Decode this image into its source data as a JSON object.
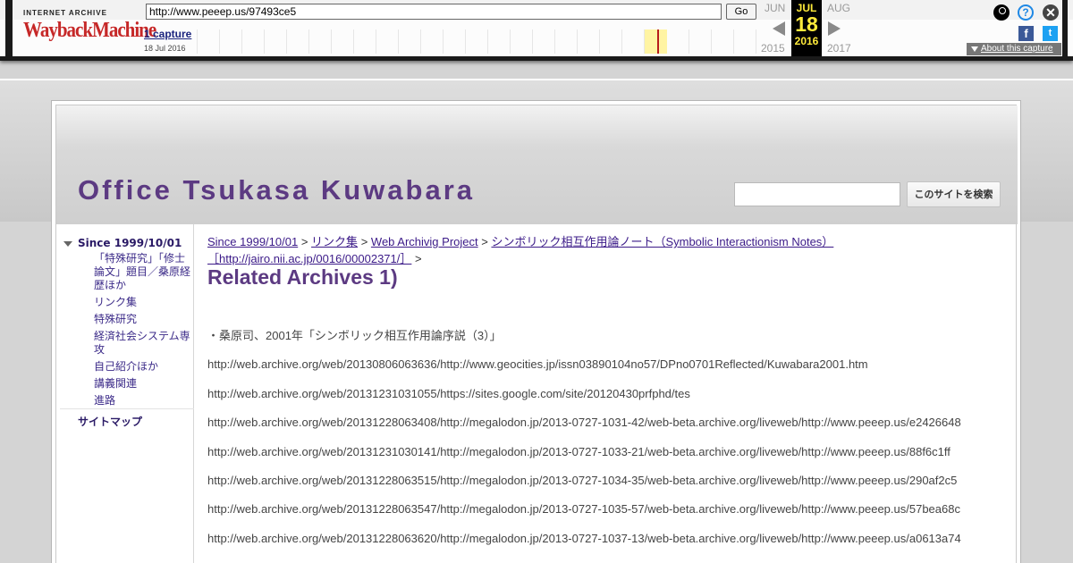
{
  "wayback": {
    "logo_top": "INTERNET ARCHIVE",
    "logo_main": "WaybackMachine",
    "url": "http://www.peeep.us/97493ce5",
    "go_label": "Go",
    "captures_label": "1 capture",
    "capture_date": "18 Jul 2016",
    "prev_month": "JUN",
    "current_month": "JUL",
    "next_month": "AUG",
    "current_day": "18",
    "prev_year": "2015",
    "current_year": "2016",
    "next_year": "2017",
    "about_label": "About this capture",
    "help_glyph": "?",
    "close_glyph": "✕",
    "facebook_glyph": "f",
    "twitter_glyph": "t"
  },
  "site": {
    "title": "Office Tsukasa Kuwabara",
    "search_button": "このサイトを検索",
    "search_placeholder": ""
  },
  "sidebar": {
    "root": "Since 1999/10/01",
    "items": [
      "「特殊研究」「修士論文」題目／桑原経歴ほか",
      "リンク集",
      "特殊研究",
      "経済社会システム専攻",
      "自己紹介ほか",
      "講義関連",
      "進路"
    ],
    "sitemap": "サイトマップ"
  },
  "content": {
    "breadcrumb": {
      "crumb1": "Since 1999/10/01",
      "crumb2": "リンク集",
      "crumb3": "Web Archivig Project",
      "crumb4": "シンボリック相互作用論ノート（Symbolic Interactionism Notes）［http://jairo.nii.ac.jp/0016/00002371/］",
      "sep": ">"
    },
    "heading": "Related Archives 1)",
    "lines": [
      "・桑原司、2001年「シンボリック相互作用論序説（3）」",
      "http://web.archive.org/web/20130806063636/http://www.geocities.jp/issn03890104no57/DPno0701Reflected/Kuwabara2001.htm",
      "http://web.archive.org/web/20131231031055/https://sites.google.com/site/20120430prfphd/tes",
      "http://web.archive.org/web/20131228063408/http://megalodon.jp/2013-0727-1031-42/web-beta.archive.org/liveweb/http://www.peeep.us/e2426648",
      "http://web.archive.org/web/20131231030141/http://megalodon.jp/2013-0727-1033-21/web-beta.archive.org/liveweb/http://www.peeep.us/88f6c1ff",
      "http://web.archive.org/web/20131228063515/http://megalodon.jp/2013-0727-1034-35/web-beta.archive.org/liveweb/http://www.peeep.us/290af2c5",
      "http://web.archive.org/web/20131228063547/http://megalodon.jp/2013-0727-1035-57/web-beta.archive.org/liveweb/http://www.peeep.us/57bea68c",
      "http://web.archive.org/web/20131228063620/http://megalodon.jp/2013-0727-1037-13/web-beta.archive.org/liveweb/http://www.peeep.us/a0613a74"
    ]
  }
}
